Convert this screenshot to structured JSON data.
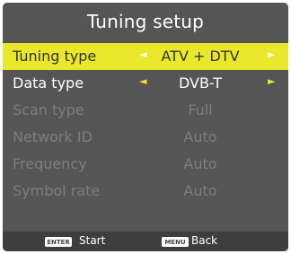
{
  "title": "Tuning setup",
  "rows": [
    {
      "label": "Tuning type",
      "value": "ATV + DTV",
      "arrow_left": "◄",
      "arrow_right": "►",
      "state": "selected"
    },
    {
      "label": "Data type",
      "value": "DVB-T",
      "arrow_left": "◄",
      "arrow_right": "►",
      "state": "active"
    },
    {
      "label": "Scan type",
      "value": "Full",
      "state": "disabled"
    },
    {
      "label": "Network ID",
      "value": "Auto",
      "state": "disabled"
    },
    {
      "label": "Frequency",
      "value": "Auto",
      "state": "disabled"
    },
    {
      "label": "Symbol rate",
      "value": "Auto",
      "state": "disabled"
    }
  ],
  "footer": {
    "enter_key": "ENTER",
    "enter_label": "Start",
    "menu_key": "MENU",
    "menu_label": "Back"
  },
  "colors": {
    "panel_bg": "#555555",
    "highlight": "#e9e82a",
    "disabled_text": "#7e7e7e",
    "footer_bg": "#3e3e3e"
  }
}
